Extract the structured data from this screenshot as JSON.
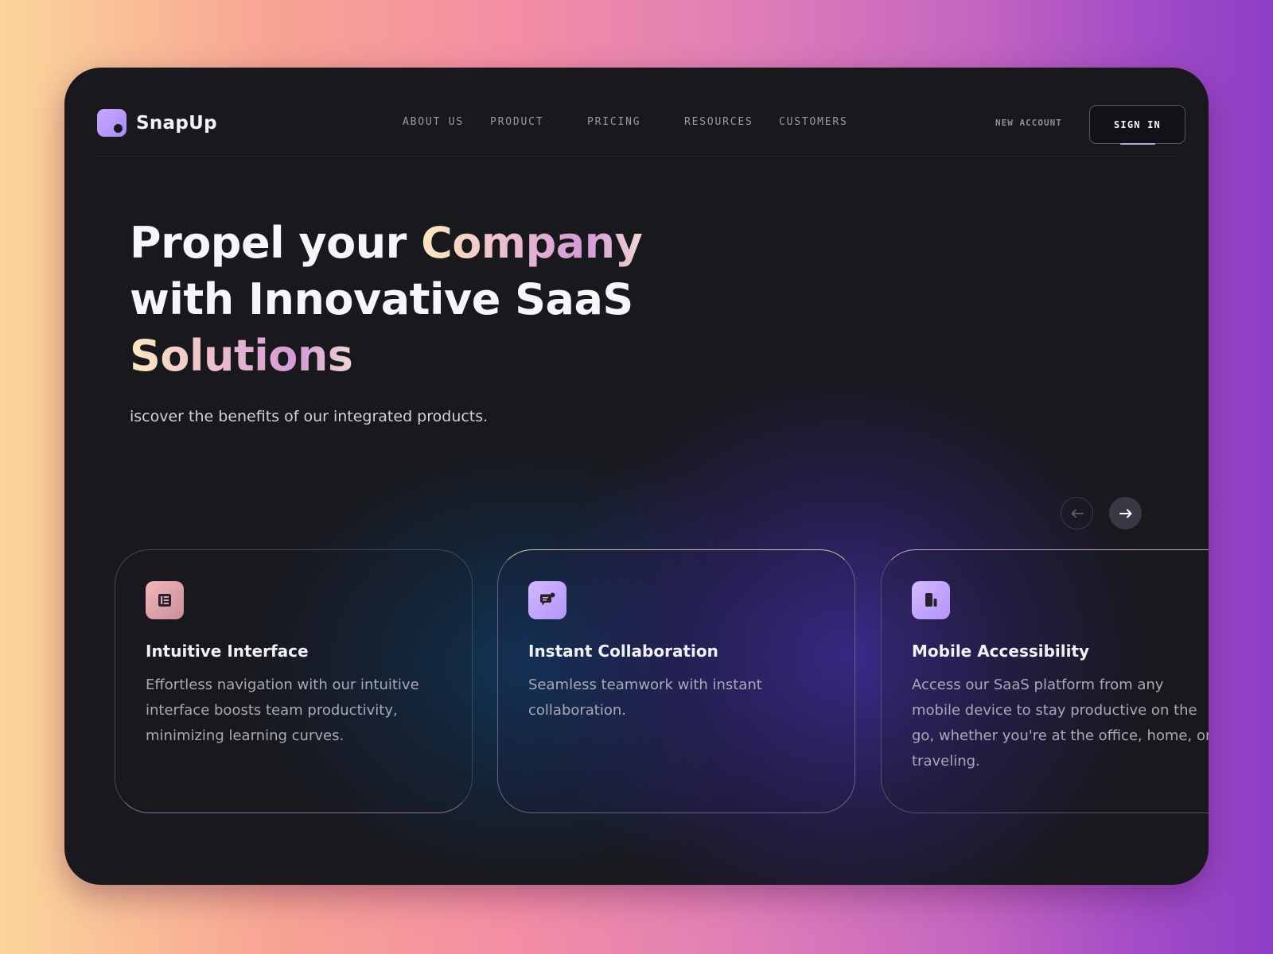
{
  "brand": {
    "name": "SnapUp"
  },
  "nav": {
    "items": [
      {
        "label": "ABOUT US"
      },
      {
        "label": "PRODUCT"
      },
      {
        "label": "PRICING"
      },
      {
        "label": "RESOURCES"
      },
      {
        "label": "CUSTOMERS"
      }
    ],
    "new_account_label": "NEW ACCOUNT",
    "sign_in_label": "SIGN IN"
  },
  "hero": {
    "title_line1_a": "Propel your ",
    "title_line1_b": "Company",
    "title_line2": "with Innovative SaaS",
    "title_line3": "Solutions",
    "subtitle": "iscover the benefits of our integrated products."
  },
  "carousel": {
    "prev_icon": "arrow-left-icon",
    "next_icon": "arrow-right-icon"
  },
  "cards": [
    {
      "icon": "layout-icon",
      "title": "Intuitive Interface",
      "description": "Effortless navigation with our intuitive interface boosts team productivity, minimizing learning curves."
    },
    {
      "icon": "chat-icon",
      "title": "Instant Collaboration",
      "description": "Seamless teamwork with instant collaboration."
    },
    {
      "icon": "mobile-devices-icon",
      "title": "Mobile Accessibility",
      "description": "Access our SaaS platform from any mobile device to stay productive on the go, whether you're at the office, home, or traveling."
    }
  ],
  "colors": {
    "panel_bg": "#19181c",
    "accent_purple": "#c4a6ff",
    "accent_pink": "#e9aeb3",
    "text_primary": "#f6f5f8",
    "text_muted": "#a9a8b6"
  }
}
